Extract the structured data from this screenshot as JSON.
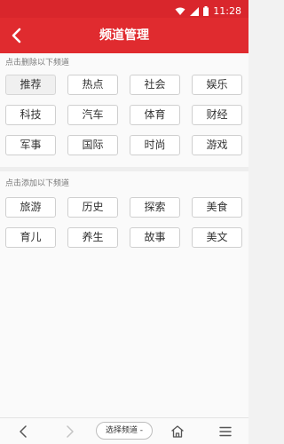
{
  "status": {
    "time": "11:28"
  },
  "app": {
    "title": "频道管理",
    "back_icon": "chevron-left-icon"
  },
  "subscribed": {
    "hint": "点击删除以下频道",
    "items": [
      "推荐",
      "热点",
      "社会",
      "娱乐",
      "科技",
      "汽车",
      "体育",
      "财经",
      "军事",
      "国际",
      "时尚",
      "游戏"
    ],
    "selected_index": 0
  },
  "available": {
    "hint": "点击添加以下频道",
    "items": [
      "旅游",
      "历史",
      "探索",
      "美食",
      "育儿",
      "养生",
      "故事",
      "美文"
    ]
  },
  "navbar": {
    "select_label": "选择频道 -"
  },
  "colors": {
    "accent": "#e02b2f"
  }
}
